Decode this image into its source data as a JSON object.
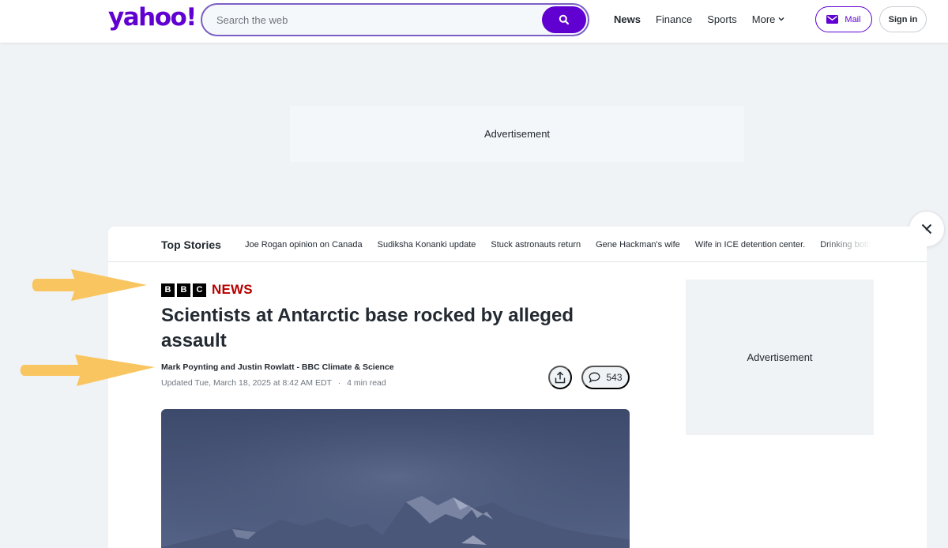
{
  "header": {
    "logo": "yahoo!",
    "search_placeholder": "Search the web",
    "nav": [
      {
        "label": "News",
        "active": true
      },
      {
        "label": "Finance",
        "active": false
      },
      {
        "label": "Sports",
        "active": false
      },
      {
        "label": "More",
        "active": false
      }
    ],
    "mail_label": "Mail",
    "signin_label": "Sign in"
  },
  "ads": {
    "top_label": "Advertisement",
    "side_label": "Advertisement"
  },
  "top_stories": {
    "label": "Top Stories",
    "items": [
      "Joe Rogan opinion on Canada",
      "Sudiksha Konanki update",
      "Stuck astronauts return",
      "Gene Hackman's wife",
      "Wife in ICE detention center.",
      "Drinking bottled water"
    ]
  },
  "article": {
    "source_letters": [
      "B",
      "B",
      "C"
    ],
    "source_word": "NEWS",
    "headline": "Scientists at Antarctic base rocked by alleged assault",
    "byline": "Mark Poynting and Justin Rowlatt - BBC Climate & Science",
    "updated": "Updated Tue, March 18, 2025 at 8:42 AM EDT",
    "separator": "·",
    "read_time": "4 min read",
    "comment_count": "543"
  },
  "colors": {
    "brand": "#6001d2",
    "bbc_red": "#b80000",
    "arrow": "#f9c561"
  }
}
